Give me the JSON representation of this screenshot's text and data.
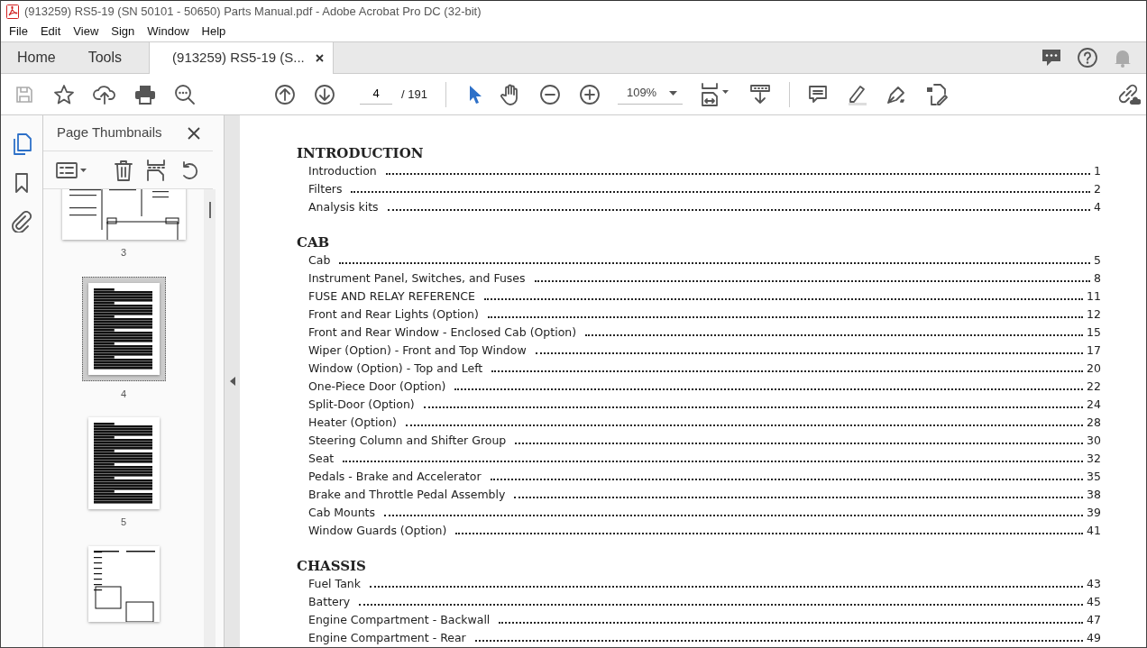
{
  "window": {
    "title": "(913259) RS5-19 (SN 50101 - 50650) Parts Manual.pdf - Adobe Acrobat Pro DC (32-bit)"
  },
  "menu": [
    "File",
    "Edit",
    "View",
    "Sign",
    "Window",
    "Help"
  ],
  "tabs": [
    {
      "label": "Home",
      "selected": false,
      "closable": false
    },
    {
      "label": "Tools",
      "selected": false,
      "closable": false
    },
    {
      "label": "(913259) RS5-19 (S...",
      "selected": true,
      "closable": true
    }
  ],
  "toolbar": {
    "page_current": "4",
    "page_total": "/  191",
    "zoom": "109%"
  },
  "sidebar": {
    "title": "Page Thumbnails",
    "rail_items": [
      {
        "kind": "pages",
        "selected": true
      },
      {
        "kind": "bookmarks",
        "selected": false
      },
      {
        "kind": "attachments",
        "selected": false
      }
    ],
    "thumbnails": [
      {
        "label": "3",
        "kind": "diagram",
        "selected": false
      },
      {
        "label": "4",
        "kind": "list",
        "selected": true
      },
      {
        "label": "5",
        "kind": "list",
        "selected": false
      },
      {
        "kind": "mixed",
        "selected": false
      }
    ]
  },
  "document": {
    "sections": [
      {
        "heading": "INTRODUCTION",
        "entries": [
          {
            "title": "Introduction",
            "page": "1"
          },
          {
            "title": "Filters",
            "page": "2"
          },
          {
            "title": "Analysis kits",
            "page": "4"
          }
        ]
      },
      {
        "heading": "CAB",
        "entries": [
          {
            "title": "Cab",
            "page": "5"
          },
          {
            "title": "Instrument Panel, Switches, and Fuses",
            "page": "8"
          },
          {
            "title": "FUSE AND RELAY REFERENCE",
            "page": "11"
          },
          {
            "title": "Front and Rear Lights (Option)",
            "page": "12"
          },
          {
            "title": "Front and Rear Window - Enclosed Cab (Option)",
            "page": "15"
          },
          {
            "title": "Wiper (Option) - Front and Top Window",
            "page": "17"
          },
          {
            "title": "Window (Option) - Top and Left",
            "page": "20"
          },
          {
            "title": "One-Piece Door (Option)",
            "page": "22"
          },
          {
            "title": "Split-Door (Option)",
            "page": "24"
          },
          {
            "title": "Heater (Option)",
            "page": "28"
          },
          {
            "title": "Steering Column and Shifter Group",
            "page": "30"
          },
          {
            "title": "Seat",
            "page": "32"
          },
          {
            "title": "Pedals - Brake and Accelerator",
            "page": "35"
          },
          {
            "title": "Brake and Throttle Pedal Assembly",
            "page": "38"
          },
          {
            "title": "Cab Mounts",
            "page": "39"
          },
          {
            "title": "Window Guards (Option)",
            "page": "41"
          }
        ]
      },
      {
        "heading": "CHASSIS",
        "entries": [
          {
            "title": "Fuel Tank",
            "page": "43"
          },
          {
            "title": "Battery",
            "page": "45"
          },
          {
            "title": "Engine Compartment - Backwall",
            "page": "47"
          },
          {
            "title": "Engine Compartment - Rear",
            "page": "49"
          }
        ]
      }
    ]
  }
}
